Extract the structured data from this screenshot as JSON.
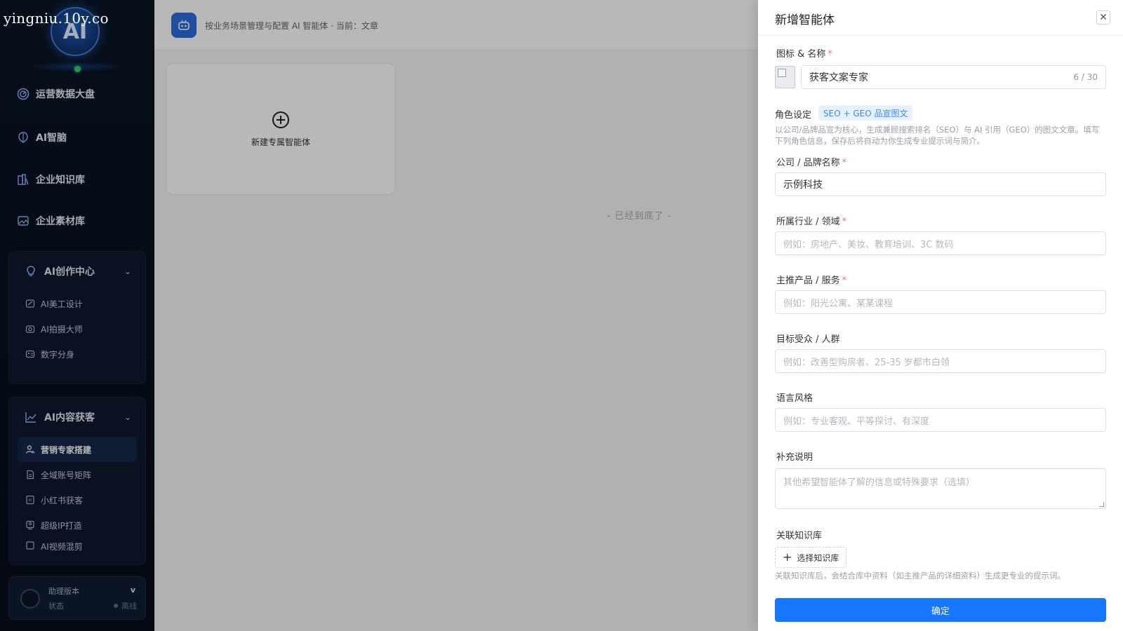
{
  "watermark": "yingniu.10y.co",
  "sidebar": {
    "logo_text": "AI",
    "nav": [
      {
        "label": "运营数据大盘",
        "icon": "dashboard-icon"
      },
      {
        "label": "AI智脑",
        "icon": "brain-icon"
      },
      {
        "label": "企业知识库",
        "icon": "knowledge-base-icon"
      },
      {
        "label": "企业素材库",
        "icon": "image-library-icon"
      }
    ],
    "groups": [
      {
        "title": "AI创作中心",
        "icon": "lightbulb-icon",
        "items": [
          {
            "label": "AI美工设计",
            "icon": "design-icon"
          },
          {
            "label": "AI拍摄大师",
            "icon": "camera-icon"
          },
          {
            "label": "数字分身",
            "icon": "digital-avatar-icon"
          }
        ]
      },
      {
        "title": "AI内容获客",
        "icon": "chart-line-icon",
        "items": [
          {
            "label": "营销专家搭建",
            "icon": "user-expert-icon",
            "active": true
          },
          {
            "label": "全域账号矩阵",
            "icon": "document-icon"
          },
          {
            "label": "小红书获客",
            "icon": "ai-doc-icon"
          },
          {
            "label": "超级IP打造",
            "icon": "ip-icon"
          },
          {
            "label": "AI视频混剪",
            "icon": "video-icon"
          }
        ]
      }
    ],
    "footer": {
      "title": "助理版本",
      "version_glyph": "v",
      "status_label": "状态",
      "status_value": "离线"
    }
  },
  "main": {
    "header_text": "按业务场景管理与配置 AI 智能体 · 当前：文章",
    "new_card_label": "新建专属智能体",
    "end_text": "- 已经到底了 -"
  },
  "drawer": {
    "title": "新增智能体",
    "close_glyph": "✕",
    "icon_name_label": "图标 & 名称",
    "name_value": "获客文案专家",
    "name_counter": "6 / 30",
    "role_label": "角色设定",
    "role_tag": "SEO + GEO 品宣图文",
    "role_help": "以公司/品牌品宣为核心，生成兼顾搜索排名（SEO）与 AI 引用（GEO）的图文文章。填写下列角色信息，保存后将自动为你生成专业提示词与简介。",
    "company_label": "公司 / 品牌名称",
    "company_value": "示例科技",
    "industry_label": "所属行业 / 领域",
    "industry_placeholder": "例如：房地产、美妆、教育培训、3C 数码",
    "product_label": "主推产品 / 服务",
    "product_placeholder": "例如：阳光公寓、某某课程",
    "audience_label": "目标受众 / 人群",
    "audience_placeholder": "例如：改善型购房者、25-35 岁都市白领",
    "style_label": "语言风格",
    "style_placeholder": "例如：专业客观、平等探讨、有深度",
    "notes_label": "补充说明",
    "notes_placeholder": "其他希望智能体了解的信息或特殊要求（选填）",
    "kb_label": "关联知识库",
    "kb_button": "选择知识库",
    "kb_help": "关联知识库后，会结合库中资料（如主推产品的详细资料）生成更专业的提示词。",
    "confirm_label": "确定",
    "required_mark": "*"
  }
}
